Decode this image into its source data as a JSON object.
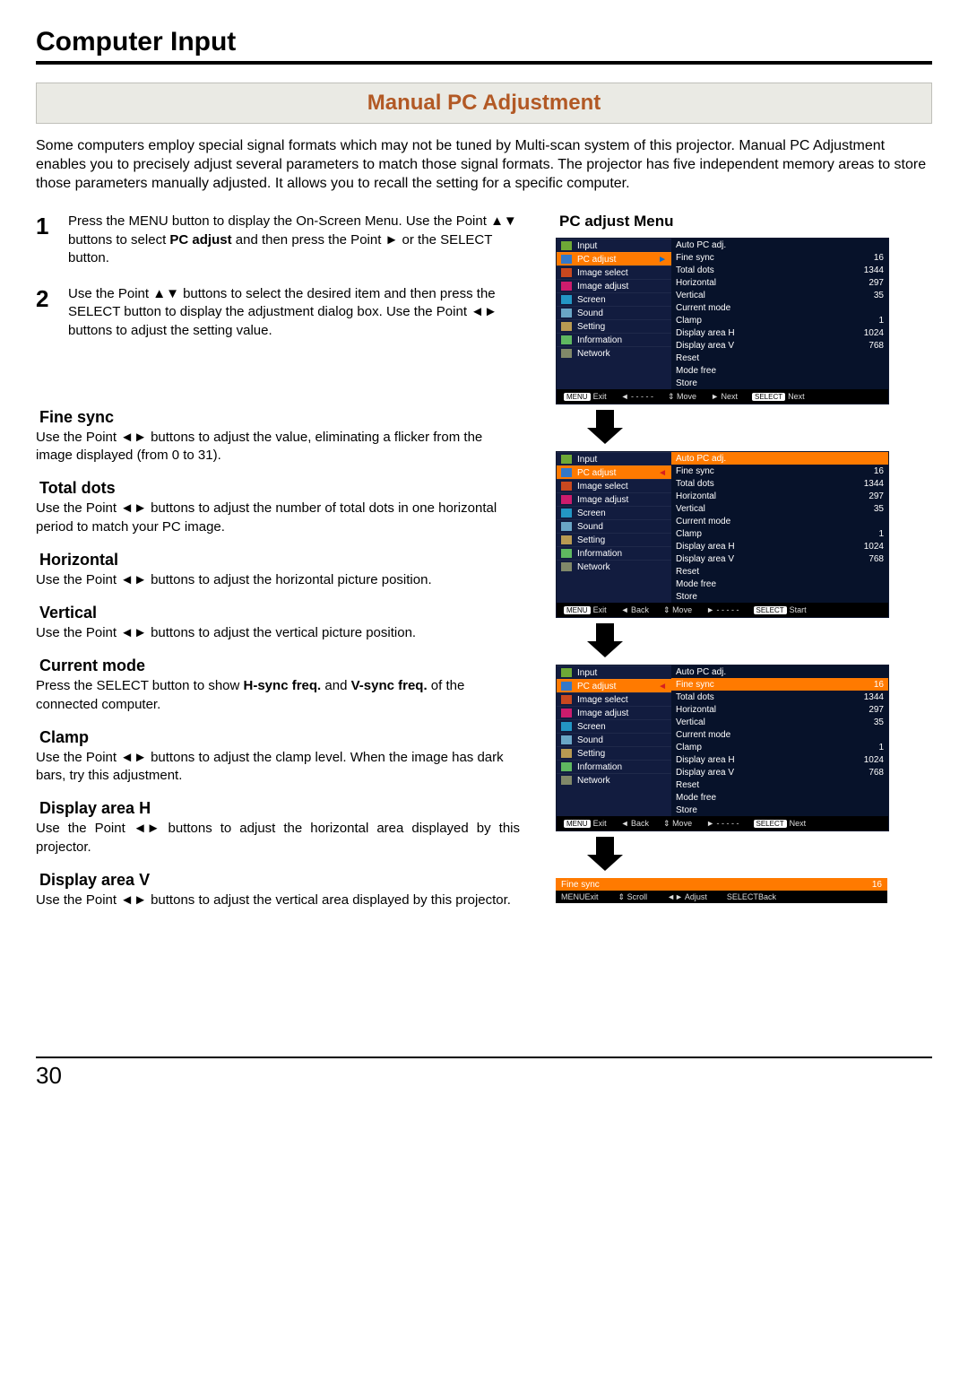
{
  "page_title": "Computer Input",
  "section_heading": "Manual PC Adjustment",
  "intro": "Some computers employ special signal formats which may not be tuned by Multi-scan system of this projector. Manual PC Adjustment enables you to precisely adjust several parameters to match those signal formats. The projector has five independent memory areas to store those parameters manually adjusted. It allows you to recall the setting for a specific computer.",
  "step1_pre": "Press the MENU button to display the On-Screen Menu. Use the Point ▲▼ buttons to select ",
  "step1_bold": "PC adjust",
  "step1_post": " and then press the Point ► or the SELECT button.",
  "step2": "Use the Point ▲▼ buttons to select the desired item and then press the SELECT button to display the adjustment dialog box. Use the Point ◄► buttons to adjust the setting value.",
  "params": {
    "fine_sync": {
      "title": "Fine sync",
      "body": "Use the Point ◄► buttons to adjust the value, eliminating a flicker from the image displayed (from 0 to 31)."
    },
    "total_dots": {
      "title": "Total dots",
      "body": "Use the Point ◄► buttons to adjust the number of total dots in one horizontal period to match your PC image."
    },
    "horizontal": {
      "title": "Horizontal",
      "body": "Use the Point ◄► buttons to adjust the horizontal picture position."
    },
    "vertical": {
      "title": "Vertical",
      "body": "Use the Point ◄► buttons to adjust the vertical picture position."
    },
    "current_mode": {
      "title": "Current mode",
      "body_pre": "Press the SELECT button to show ",
      "body_b1": "H-sync freq.",
      "body_mid": " and ",
      "body_b2": "V-sync freq.",
      "body_post": " of the connected computer."
    },
    "clamp": {
      "title": "Clamp",
      "body": "Use the Point ◄► buttons to adjust the clamp level. When the image has dark bars, try this adjustment."
    },
    "disp_h": {
      "title": "Display area H",
      "body": "Use the Point ◄► buttons to adjust the horizontal area displayed by this projector."
    },
    "disp_v": {
      "title": "Display area V",
      "body": "Use the Point ◄► buttons to adjust the vertical area displayed by this projector."
    }
  },
  "menu_title": "PC adjust Menu",
  "osd_left": [
    {
      "label": "Input",
      "icon": "ic-input"
    },
    {
      "label": "PC adjust",
      "icon": "ic-pc"
    },
    {
      "label": "Image select",
      "icon": "ic-imgs"
    },
    {
      "label": "Image adjust",
      "icon": "ic-imga"
    },
    {
      "label": "Screen",
      "icon": "ic-screen"
    },
    {
      "label": "Sound",
      "icon": "ic-sound"
    },
    {
      "label": "Setting",
      "icon": "ic-set"
    },
    {
      "label": "Information",
      "icon": "ic-info"
    },
    {
      "label": "Network",
      "icon": "ic-net"
    }
  ],
  "osd_right": [
    {
      "label": "Auto PC adj.",
      "value": ""
    },
    {
      "label": "Fine sync",
      "value": "16"
    },
    {
      "label": "Total dots",
      "value": "1344"
    },
    {
      "label": "Horizontal",
      "value": "297"
    },
    {
      "label": "Vertical",
      "value": "35"
    },
    {
      "label": "Current mode",
      "value": ""
    },
    {
      "label": "Clamp",
      "value": "1"
    },
    {
      "label": "Display area H",
      "value": "1024"
    },
    {
      "label": "Display area V",
      "value": "768"
    },
    {
      "label": "Reset",
      "value": ""
    },
    {
      "label": "Mode free",
      "value": ""
    },
    {
      "label": "Store",
      "value": ""
    }
  ],
  "footer_keys": {
    "menu": "MENU",
    "exit": "Exit",
    "back": "Back",
    "move": "Move",
    "next": "Next",
    "start": "Start",
    "select": "SELECT",
    "scroll": "Scroll",
    "adjust": "Adjust",
    "dash": "- - - - -"
  },
  "adjust_bar": {
    "label": "Fine sync",
    "value": "16"
  },
  "glyph_arrow_left": "◄",
  "glyph_arrow_right": "►",
  "glyph_arrow_lr": "◄►",
  "glyph_arrow_ud": "▲▼",
  "page_number": "30"
}
